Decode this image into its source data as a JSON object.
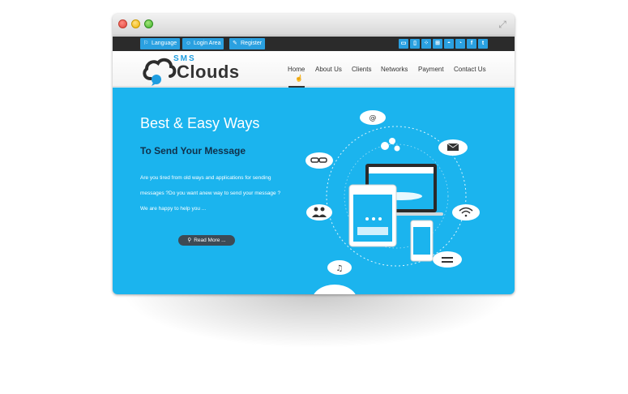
{
  "window": {
    "controls": [
      "close",
      "minimize",
      "zoom"
    ],
    "resize_icon": "expand-arrows-icon"
  },
  "topbar": {
    "language_label": "Language",
    "login_label": "Login Area",
    "register_label": "Register",
    "social_icons": [
      "monitor-icon",
      "mobile-icon",
      "blackberry-icon",
      "windows-icon",
      "android-icon",
      "rss-icon",
      "facebook-icon",
      "twitter-icon"
    ]
  },
  "logo": {
    "small_text": "SMS",
    "big_text": "Clouds"
  },
  "nav": {
    "items": [
      {
        "label": "Home",
        "active": true
      },
      {
        "label": "About Us"
      },
      {
        "label": "Clients"
      },
      {
        "label": "Networks"
      },
      {
        "label": "Payment"
      },
      {
        "label": "Contact Us"
      }
    ]
  },
  "hero": {
    "title": "Best & Easy Ways",
    "subtitle": "To Send Your Message",
    "lines": [
      "Are you tired from old ways and applications for sending",
      "messages ?Do you want anew way to send your message ?",
      "We are happy to help you ..."
    ],
    "button_label": "Read More ...",
    "illustration_icons": [
      "at-icon",
      "gears-icon",
      "mail-icon",
      "link-icon",
      "group-icon",
      "wifi-icon",
      "music-icon",
      "equals-icon"
    ]
  },
  "colors": {
    "hero_bg": "#1bb4ee",
    "accent": "#2aa0e0",
    "topbar_bg": "#2b2b2b",
    "subtitle": "#10304a",
    "button_bg": "#3d4a55"
  }
}
